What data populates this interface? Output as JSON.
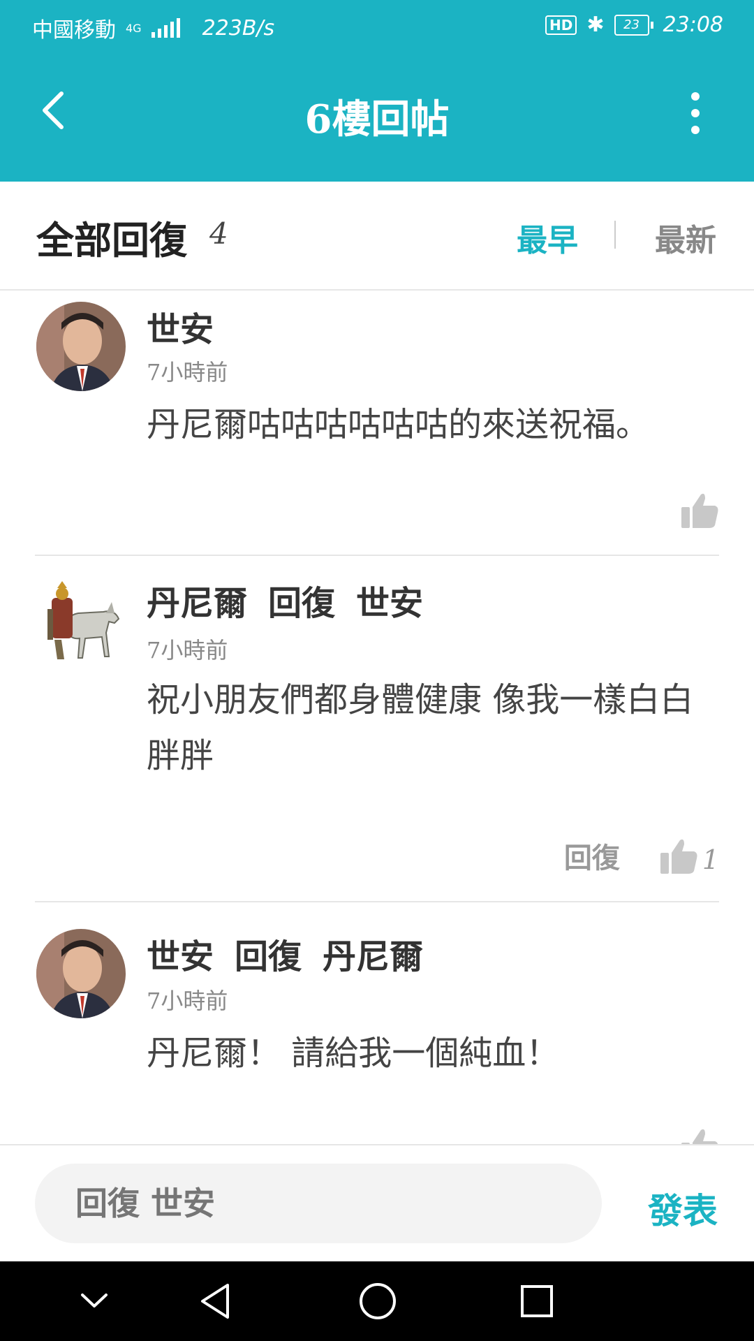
{
  "status_bar": {
    "carrier": "中國移動",
    "network": "4G",
    "speed": "223B/s",
    "hd": "HD",
    "battery": "23",
    "time": "23:08"
  },
  "app_bar": {
    "title": "6樓回帖",
    "back_icon": "chevron-left-icon",
    "more_icon": "more-vertical-icon"
  },
  "replies_header": {
    "label": "全部回復",
    "count": "4",
    "sort_earliest": "最早",
    "sort_latest": "最新",
    "accent_color": "#1bb3c3"
  },
  "replies": [
    {
      "author": "世安",
      "reply_verb": "",
      "reply_to": "",
      "time": "7小時前",
      "content": "丹尼爾咕咕咕咕咕咕的來送祝福。",
      "reply_label": "",
      "likes": ""
    },
    {
      "author": "丹尼爾",
      "reply_verb": "回復",
      "reply_to": "世安",
      "time": "7小時前",
      "content": "祝小朋友們都身體健康 像我一樣白白胖胖",
      "reply_label": "回復",
      "likes": "1"
    },
    {
      "author": "世安",
      "reply_verb": "回復",
      "reply_to": "丹尼爾",
      "time": "7小時前",
      "content": "丹尼爾！ 請給我一個純血！",
      "reply_label": "",
      "likes": ""
    }
  ],
  "composer": {
    "placeholder": "回復 世安",
    "send_label": "發表"
  },
  "nav_bar": {
    "icons": [
      "chevron-down-icon",
      "back-triangle-icon",
      "home-circle-icon",
      "recents-square-icon"
    ]
  }
}
